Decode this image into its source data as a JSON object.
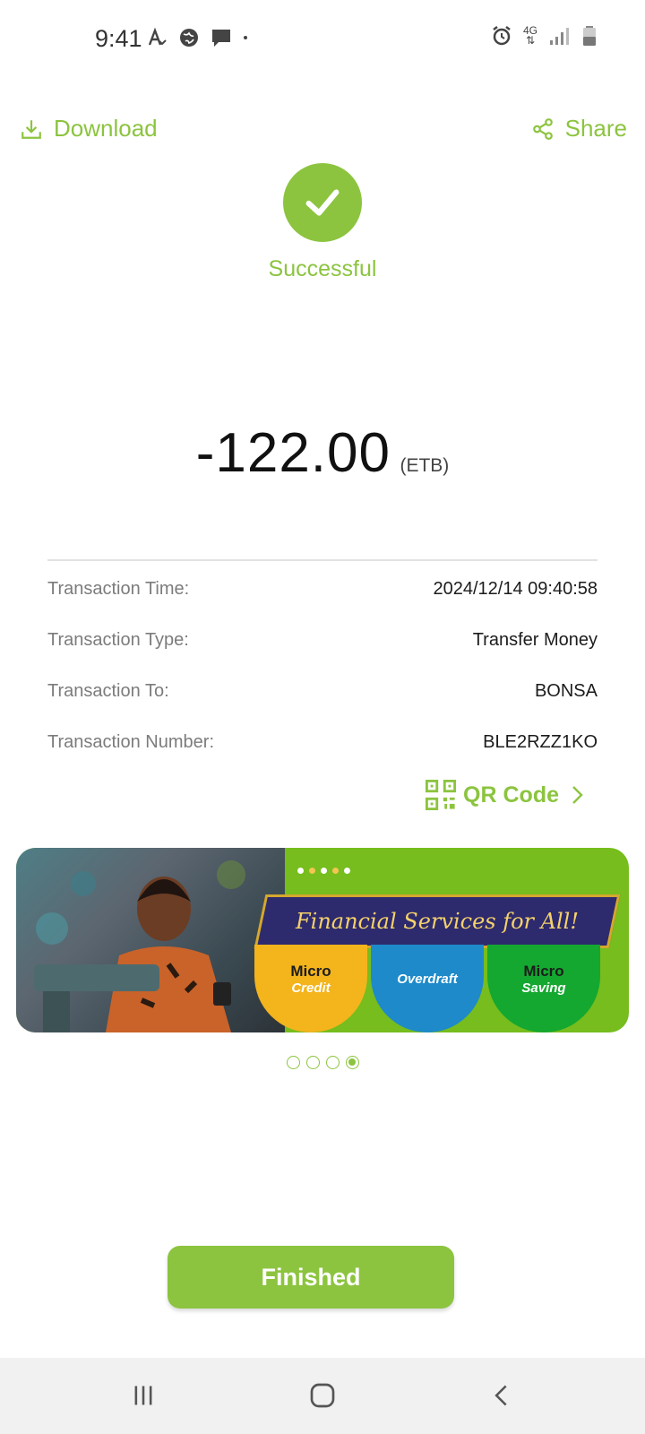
{
  "status_bar": {
    "time": "9:41",
    "left_icons": [
      "auto-translate-icon",
      "browser-icon",
      "message-icon",
      "notification-dot-icon"
    ],
    "right_icons": [
      "alarm-icon",
      "4g-data-icon",
      "signal-icon",
      "battery-icon"
    ],
    "network_label": "4G"
  },
  "actions": {
    "download_label": "Download",
    "share_label": "Share"
  },
  "result": {
    "status": "Successful",
    "amount": "-122.00",
    "currency": "(ETB)"
  },
  "details": {
    "rows": [
      {
        "label": "Transaction Time:",
        "value": "2024/12/14 09:40:58"
      },
      {
        "label": "Transaction Type:",
        "value": "Transfer Money"
      },
      {
        "label": "Transaction To:",
        "value": "BONSA"
      },
      {
        "label": "Transaction Number:",
        "value": "BLE2RZZ1KO"
      }
    ],
    "qr_label": "QR Code"
  },
  "banner": {
    "headline": "Financial Services for All!",
    "badges": [
      {
        "line1": "Micro",
        "line2": "Credit"
      },
      {
        "line1": "Overdraft",
        "line2": ""
      },
      {
        "line1": "Micro",
        "line2": "Saving"
      }
    ]
  },
  "pager": {
    "count": 4,
    "active_index": 3
  },
  "footer": {
    "finished_label": "Finished"
  },
  "colors": {
    "accent": "#8cc43f",
    "banner_green": "#76bd1d"
  }
}
